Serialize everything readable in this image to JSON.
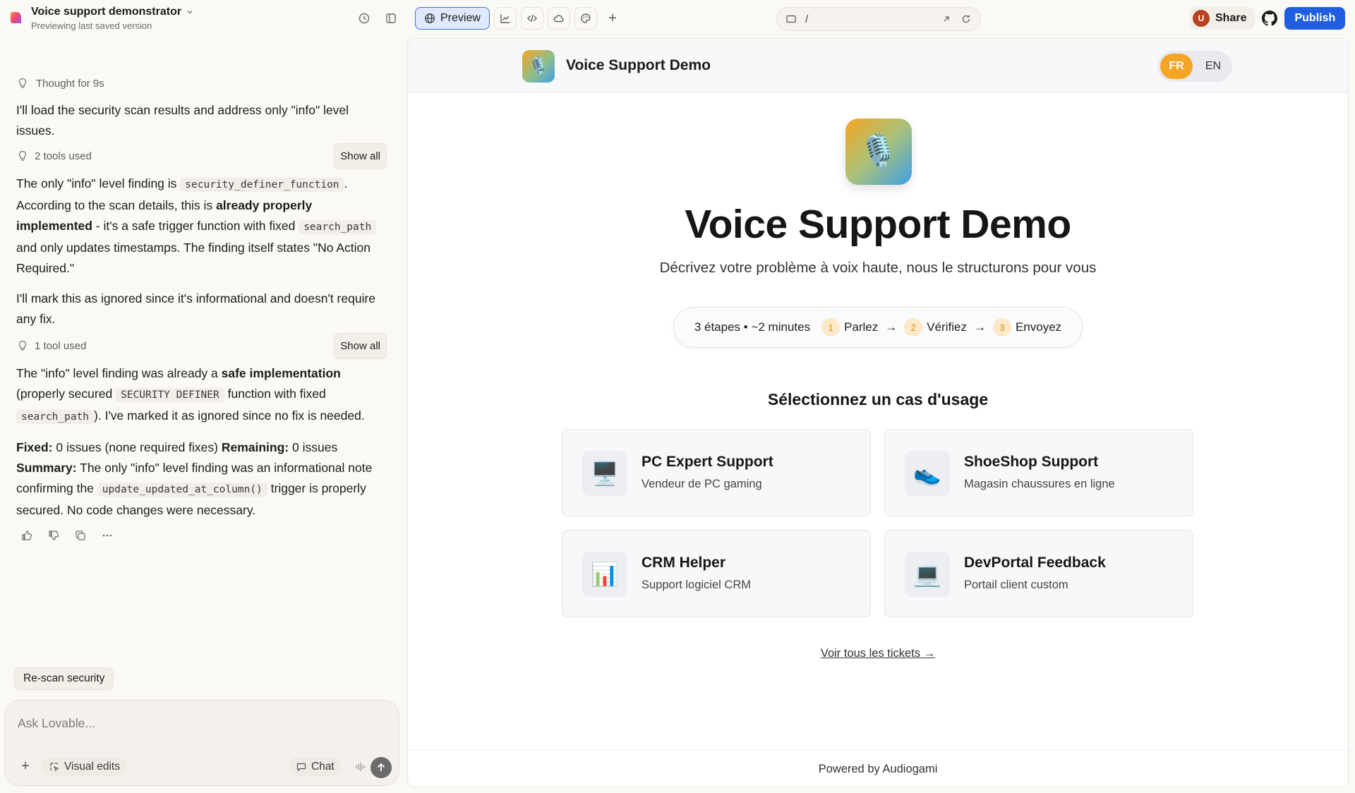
{
  "project": {
    "title": "Voice support demonstrator",
    "subtitle": "Previewing last saved version"
  },
  "chat": {
    "thought": "Thought for 9s",
    "intro": "I'll load the security scan results and address only \"info\" level issues.",
    "tools1_label": "2 tools used",
    "show_all": "Show all",
    "p1_a": "The only \"info\" level finding is ",
    "p1_code": "security_definer_function",
    "p1_b": ". According to the scan details, this is ",
    "p1_bold": "already properly implemented",
    "p1_c": " - it's a safe trigger function with fixed ",
    "p1_code2": "search_path",
    "p1_d": " and only updates timestamps. The finding itself states \"No Action Required.\"",
    "p2": "I'll mark this as ignored since it's informational and doesn't require any fix.",
    "tools2_label": "1 tool used",
    "p3_a": "The \"info\" level finding was already a ",
    "p3_bold": "safe implementation",
    "p3_b": " (properly secured ",
    "p3_code": "SECURITY DEFINER",
    "p3_c": " function with fixed ",
    "p3_code2": "search_path",
    "p3_d": "). I've marked it as ignored since no fix is needed.",
    "fixed_label": "Fixed:",
    "fixed_text": " 0 issues (none required fixes) ",
    "remaining_label": "Remaining:",
    "remaining_text": " 0 issues",
    "summary_label": "Summary:",
    "summary_a": " The only \"info\" level finding was an informational note confirming the ",
    "summary_code": "update_updated_at_column()",
    "summary_b": " trigger is properly secured. No code changes were necessary."
  },
  "suggestion": "Re-scan security",
  "composer": {
    "placeholder": "Ask Lovable...",
    "visual_edits": "Visual edits",
    "chat": "Chat"
  },
  "toolbar": {
    "preview": "Preview",
    "url_path": "/"
  },
  "actions": {
    "avatar_initial": "U",
    "share": "Share",
    "publish": "Publish"
  },
  "app": {
    "name": "Voice Support Demo",
    "lang_fr": "FR",
    "lang_en": "EN",
    "hero_title": "Voice Support Demo",
    "hero_sub": "Décrivez votre problème à voix haute, nous le structurons pour vous",
    "steps_intro": "3 étapes • ~2 minutes",
    "steps": [
      {
        "num": "1",
        "label": "Parlez"
      },
      {
        "num": "2",
        "label": "Vérifiez"
      },
      {
        "num": "3",
        "label": "Envoyez"
      }
    ],
    "section_title": "Sélectionnez un cas d'usage",
    "cards": [
      {
        "icon": "🖥️",
        "title": "PC Expert Support",
        "sub": "Vendeur de PC gaming"
      },
      {
        "icon": "👟",
        "title": "ShoeShop Support",
        "sub": "Magasin chaussures en ligne"
      },
      {
        "icon": "📊",
        "title": "CRM Helper",
        "sub": "Support logiciel CRM"
      },
      {
        "icon": "💻",
        "title": "DevPortal Feedback",
        "sub": "Portail client custom"
      }
    ],
    "tickets_link": "Voir tous les tickets →",
    "footer": "Powered by Audiogami",
    "hero_icon": "🎙️"
  },
  "colors": {
    "accent": "#1f5ee0",
    "lang_active": "#f5a524",
    "preview_border": "#3c6fd6"
  }
}
